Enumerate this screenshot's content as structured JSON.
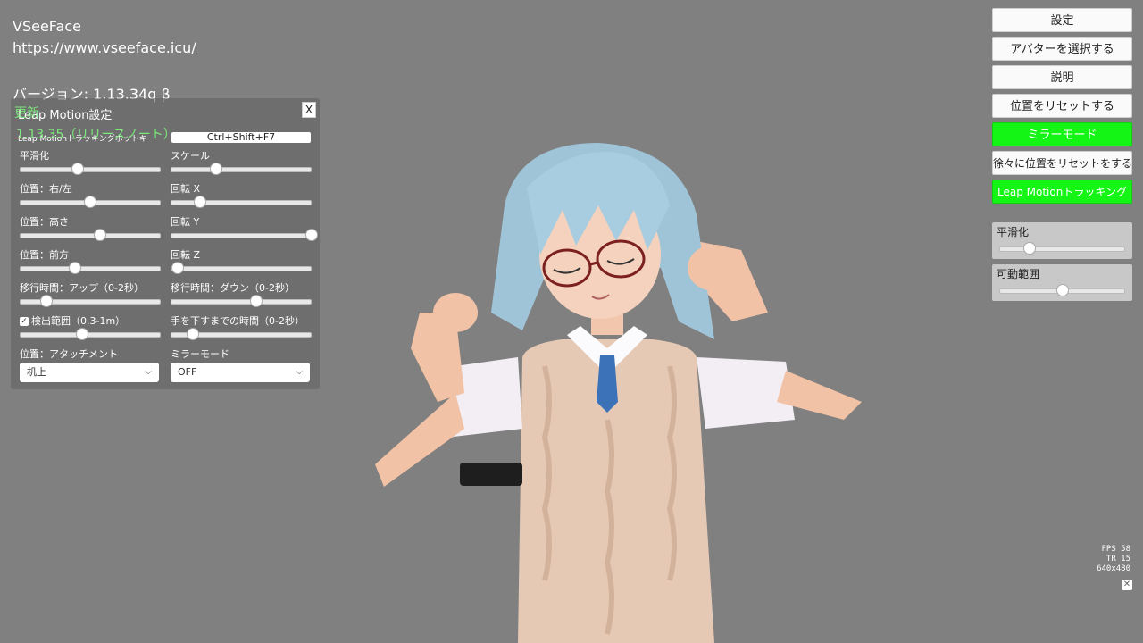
{
  "app": {
    "name": "VSeeFace",
    "url": "https://www.vseeface.icu/",
    "version": "バージョン: 1.13.34q β",
    "update_label": "更新",
    "update_version": "1.13.35（リリースノート）"
  },
  "leap_panel": {
    "title": "Leap Motion設定",
    "close": "X",
    "hotkey_label": "Leap Motionトラッキングホットキー",
    "hotkey_value": "Ctrl+Shift+F7",
    "controls": [
      {
        "label": "平滑化",
        "value": 0.41
      },
      {
        "label": "スケール",
        "value": 0.32
      },
      {
        "label": "位置：右/左",
        "value": 0.5
      },
      {
        "label": "回転 X",
        "value": 0.21
      },
      {
        "label": "位置：高さ",
        "value": 0.57
      },
      {
        "label": "回転 Y",
        "value": 1.0
      },
      {
        "label": "位置：前方",
        "value": 0.39
      },
      {
        "label": "回転 Z",
        "value": 0.05
      },
      {
        "label": "移行時間：アップ（0-2秒）",
        "value": 0.19
      },
      {
        "label": "移行時間：ダウン（0-2秒）",
        "value": 0.61
      },
      {
        "label": "検出範囲（0.3-1m）",
        "value": 0.44,
        "checked": true
      },
      {
        "label": "手を下すまでの時間（0-2秒）",
        "value": 0.16
      }
    ],
    "attachment_label": "位置：アタッチメント",
    "attachment_value": "机上",
    "mirror_label": "ミラーモード",
    "mirror_value": "OFF"
  },
  "menu": {
    "settings": "設定",
    "select_avatar": "アバターを選択する",
    "help": "説明",
    "reset_position": "位置をリセットする",
    "mirror_mode": "ミラーモード",
    "gradual_reset": "徐々に位置をリセットをする",
    "leap_tracking": "Leap Motionトラッキング"
  },
  "right_sliders": {
    "smoothing_label": "平滑化",
    "smoothing_value": 0.24,
    "range_label": "可動範囲",
    "range_value": 0.5
  },
  "stats": {
    "fps": "FPS 58",
    "tr": "TR 15",
    "resolution": "640x480",
    "close": "✕"
  },
  "colors": {
    "background": "#808080",
    "active_green": "#15f515",
    "update_green": "#7dff7d"
  }
}
